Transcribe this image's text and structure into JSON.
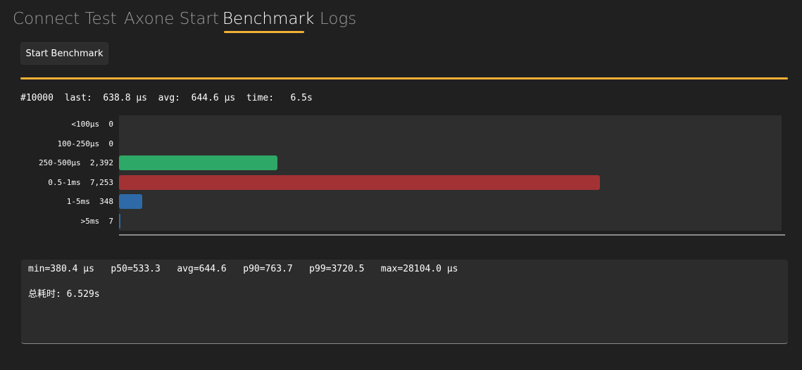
{
  "tabs": [
    {
      "label": "Connect Test",
      "active": false
    },
    {
      "label": "Axone Start",
      "active": false
    },
    {
      "label": "Benchmark",
      "active": true
    },
    {
      "label": "Logs",
      "active": false
    }
  ],
  "accent_color": "#f2b035",
  "start_button_label": "Start Benchmark",
  "progress": 1.0,
  "status": {
    "text": "#10000  last:  638.8 µs  avg:  644.6 µs  time:   6.5s"
  },
  "chart_data": {
    "type": "bar",
    "orientation": "horizontal",
    "categories": [
      "<100µs",
      "100-250µs",
      "250-500µs",
      "0.5-1ms",
      "1-5ms",
      ">5ms"
    ],
    "values": [
      0,
      0,
      2392,
      7253,
      348,
      7
    ],
    "value_labels": [
      "0",
      "0",
      "2,392",
      "7,253",
      "348",
      "7"
    ],
    "colors": [
      "#2ea866",
      "#2ea866",
      "#2ea866",
      "#a33234",
      "#2e6aa8",
      "#2e6aa8"
    ],
    "xlim": [
      0,
      10000
    ],
    "grid": false
  },
  "stats": {
    "line": "min=380.4 µs   p50=533.3   avg=644.6   p90=763.7   p99=3720.5   max=28104.0 µs",
    "total": "总耗时: 6.529s"
  }
}
